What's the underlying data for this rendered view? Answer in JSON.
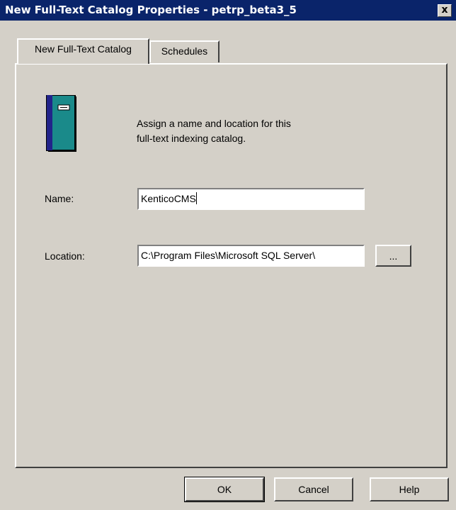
{
  "window": {
    "title": "New Full-Text Catalog Properties - petrp_beta3_5",
    "close_label": "x"
  },
  "tabs": [
    {
      "label": "New Full-Text Catalog",
      "active": true
    },
    {
      "label": "Schedules",
      "active": false
    }
  ],
  "description_line1": "Assign a name and location for this",
  "description_line2": "full-text indexing catalog.",
  "fields": {
    "name": {
      "label": "Name:",
      "value": "KenticoCMS"
    },
    "location": {
      "label": "Location:",
      "value": "C:\\Program Files\\Microsoft SQL Server\\"
    }
  },
  "browse_label": "...",
  "buttons": {
    "ok": "OK",
    "cancel": "Cancel",
    "help": "Help"
  },
  "colors": {
    "titlebar": "#0a246a",
    "face": "#d4d0c8",
    "icon_body": "#1a8a8a",
    "icon_spine": "#22238a"
  }
}
